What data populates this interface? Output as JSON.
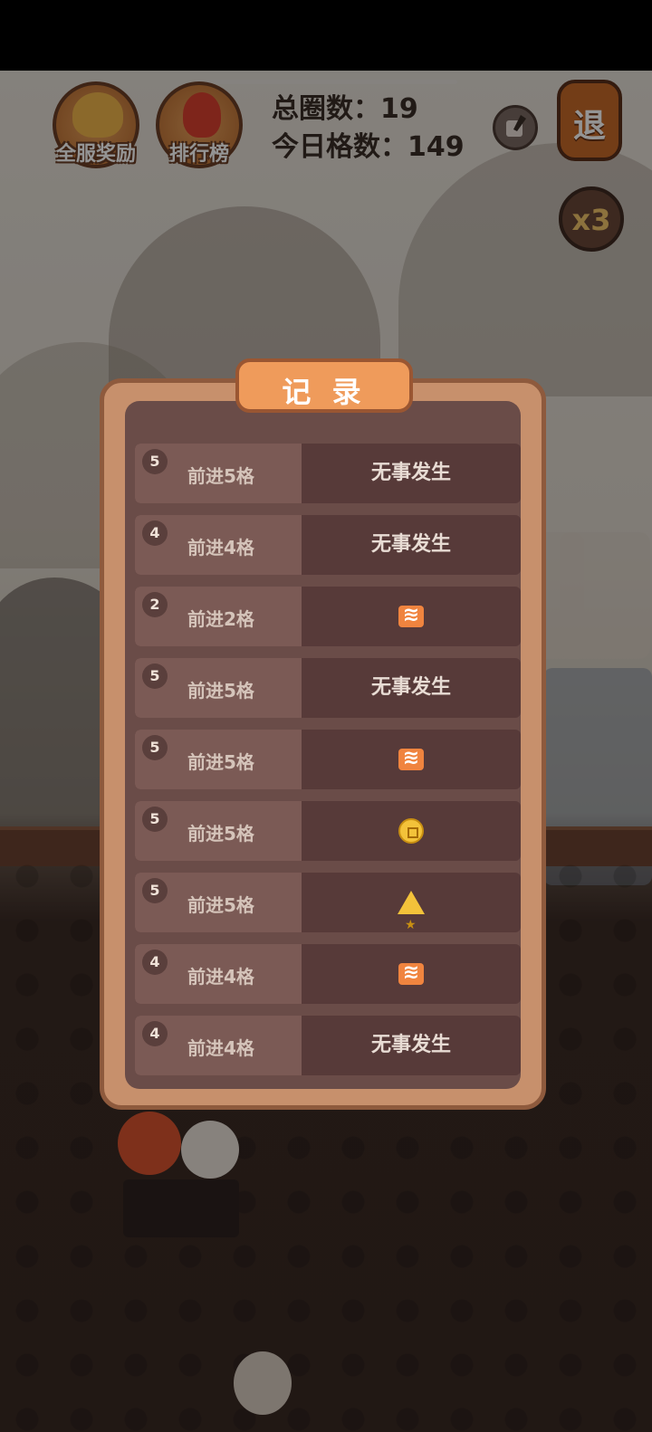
{
  "hud": {
    "server_reward_label": "全服奖励",
    "leaderboard_label": "排行榜",
    "total_laps_label": "总圈数：",
    "total_laps_value": "19",
    "today_cells_label": "今日格数：",
    "today_cells_value": "149",
    "exit_label": "退",
    "multiplier_label": "x3"
  },
  "dialog": {
    "title": "记 录",
    "records": [
      {
        "num": "5",
        "step": "前进5格",
        "result": "无事发生",
        "icon": null
      },
      {
        "num": "4",
        "step": "前进4格",
        "result": "无事发生",
        "icon": null
      },
      {
        "num": "2",
        "step": "前进2格",
        "result": "",
        "icon": "ticket-icon"
      },
      {
        "num": "5",
        "step": "前进5格",
        "result": "无事发生",
        "icon": null
      },
      {
        "num": "5",
        "step": "前进5格",
        "result": "",
        "icon": "ticket-icon"
      },
      {
        "num": "5",
        "step": "前进5格",
        "result": "",
        "icon": "coin-icon"
      },
      {
        "num": "5",
        "step": "前进5格",
        "result": "",
        "icon": "star-icon"
      },
      {
        "num": "4",
        "step": "前进4格",
        "result": "",
        "icon": "ticket-icon"
      },
      {
        "num": "4",
        "step": "前进4格",
        "result": "无事发生",
        "icon": null
      }
    ]
  },
  "colors": {
    "dialog_frame": "#c7906c",
    "dialog_inner": "#6a4c48",
    "title_bg": "#ef9b5b",
    "row_left": "#7b5a55",
    "row_right": "#573a39"
  }
}
